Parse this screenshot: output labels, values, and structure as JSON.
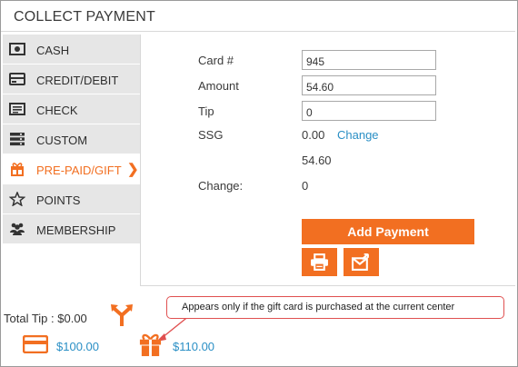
{
  "window": {
    "title": "COLLECT PAYMENT"
  },
  "sidebar": {
    "items": [
      {
        "label": "CASH",
        "icon": "cash-icon"
      },
      {
        "label": "CREDIT/DEBIT",
        "icon": "credit-card-icon"
      },
      {
        "label": "CHECK",
        "icon": "check-icon"
      },
      {
        "label": "CUSTOM",
        "icon": "custom-icon"
      },
      {
        "label": "PRE-PAID/GIFT",
        "icon": "gift-icon",
        "active": true
      },
      {
        "label": "POINTS",
        "icon": "star-icon"
      },
      {
        "label": "MEMBERSHIP",
        "icon": "people-icon"
      }
    ]
  },
  "form": {
    "card_label": "Card #",
    "card_value": "945",
    "amount_label": "Amount",
    "amount_value": "54.60",
    "tip_label": "Tip",
    "tip_value": "0",
    "ssg_label": "SSG",
    "ssg_value": "0.00",
    "ssg_change_link": "Change",
    "subtotal_value": "54.60",
    "change_label": "Change:",
    "change_value": "0"
  },
  "actions": {
    "add_payment_label": "Add Payment",
    "print_icon": "printer-icon",
    "email_icon": "email-icon"
  },
  "footer": {
    "total_tip_label": "Total Tip : $0.00",
    "tip_split_icon": "split-arrow-icon",
    "payments": [
      {
        "icon": "credit-card-icon",
        "amount": "$100.00"
      },
      {
        "icon": "gift-icon",
        "amount": "$110.00"
      }
    ]
  },
  "annotation": {
    "text": "Appears only if the gift card is purchased at the current center"
  },
  "colors": {
    "accent": "#f26f21",
    "link": "#2a8fc5",
    "callout_border": "#e05050",
    "sidebar_bg": "#e6e6e6"
  }
}
